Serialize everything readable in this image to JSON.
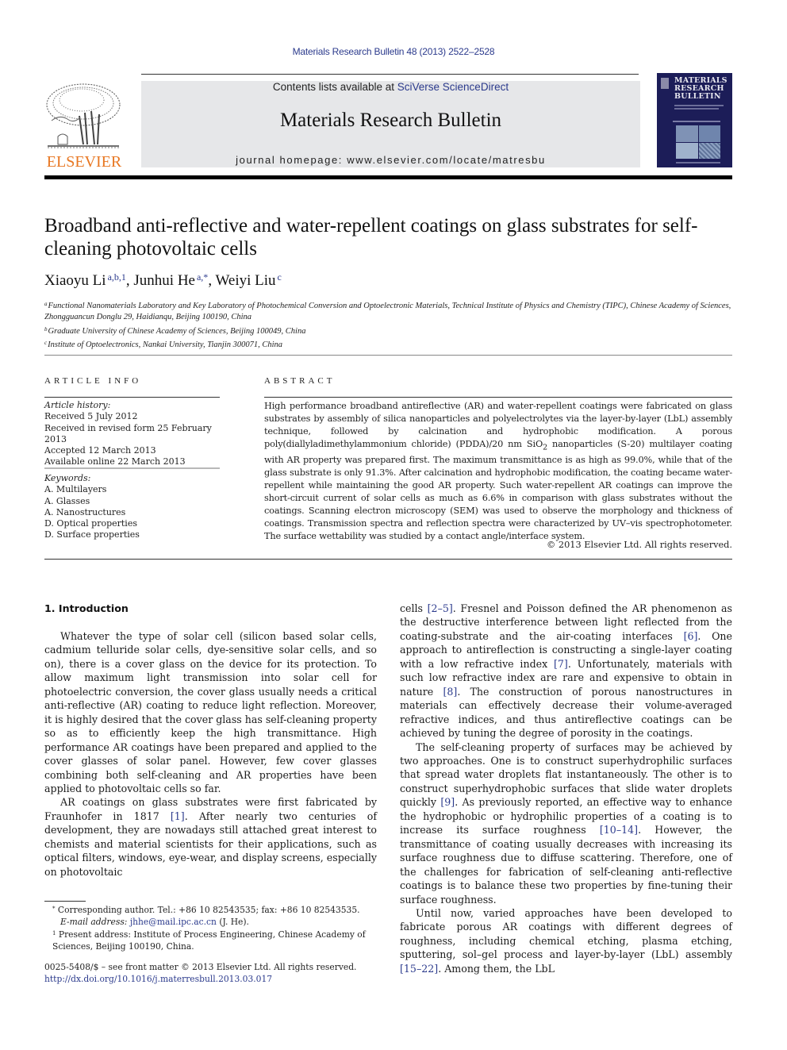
{
  "header": {
    "journal_citation": "Materials Research Bulletin 48 (2013) 2522–2528",
    "contents_prefix": "Contents lists available at ",
    "contents_link": "SciVerse ScienceDirect",
    "journal_name": "Materials Research Bulletin",
    "homepage_prefix": "journal homepage: ",
    "homepage_url": "www.elsevier.com/locate/matresbu",
    "publisher_logo_text": "ELSEVIER",
    "cover_title_lines": [
      "MATERIALS",
      "RESEARCH",
      "BULLETIN"
    ],
    "colors": {
      "link": "#2b3a8c",
      "elsevier_orange": "#e87722",
      "masthead_bg": "#e6e7e9",
      "cover_bg": "#1c1d58"
    }
  },
  "article": {
    "title": "Broadband anti-reflective and water-repellent coatings on glass substrates for self-cleaning photovoltaic cells",
    "authors": [
      {
        "name": "Xiaoyu Li",
        "marks": "a,b,1",
        "sep": ", "
      },
      {
        "name": "Junhui He",
        "marks": "a,*",
        "sep": ", "
      },
      {
        "name": "Weiyi Liu",
        "marks": "c",
        "sep": ""
      }
    ],
    "affiliations": [
      {
        "mark": "a",
        "text": "Functional Nanomaterials Laboratory and Key Laboratory of Photochemical Conversion and Optoelectronic Materials, Technical Institute of Physics and Chemistry (TIPC), Chinese Academy of Sciences, Zhongguancun Donglu 29, Haidianqu, Beijing 100190, China"
      },
      {
        "mark": "b",
        "text": "Graduate University of Chinese Academy of Sciences, Beijing 100049, China"
      },
      {
        "mark": "c",
        "text": "Institute of Optoelectronics, Nankai University, Tianjin 300071, China"
      }
    ]
  },
  "article_info": {
    "heading": "ARTICLE INFO",
    "history_label": "Article history:",
    "history": [
      "Received 5 July 2012",
      "Received in revised form 25 February 2013",
      "Accepted 12 March 2013",
      "Available online 22 March 2013"
    ],
    "keywords_label": "Keywords:",
    "keywords": [
      "A. Multilayers",
      "A. Glasses",
      "A. Nanostructures",
      "D. Optical properties",
      "D. Surface properties"
    ]
  },
  "abstract": {
    "heading": "ABSTRACT",
    "text_before_sub": "High performance broadband antireflective (AR) and water-repellent coatings were fabricated on glass substrates by assembly of silica nanoparticles and polyelectrolytes via the layer-by-layer (LbL) assembly technique, followed by calcination and hydrophobic modification. A porous poly(diallyladimethylammonium chloride) (PDDA)/20 nm SiO",
    "subscript": "2",
    "text_after_sub": " nanoparticles (S-20) multilayer coating with AR property was prepared first. The maximum transmittance is as high as 99.0%, while that of the glass substrate is only 91.3%. After calcination and hydrophobic modification, the coating became water-repellent while maintaining the good AR property. Such water-repellent AR coatings can improve the short-circuit current of solar cells as much as 6.6% in comparison with glass substrates without the coatings. Scanning electron microscopy (SEM) was used to observe the morphology and thickness of coatings. Transmission spectra and reflection spectra were characterized by UV–vis spectrophotometer. The surface wettability was studied by a contact angle/interface system.",
    "copyright": "© 2013 Elsevier Ltd. All rights reserved."
  },
  "body": {
    "section_heading": "1.  Introduction",
    "left": {
      "p1": "Whatever the type of solar cell (silicon based solar cells, cadmium telluride solar cells, dye-sensitive solar cells, and so on), there is a cover glass on the device for its protection. To allow maximum light transmission into solar cell for photoelectric conversion, the cover glass usually needs a critical anti-reflective (AR) coating to reduce light reflection. Moreover, it is highly desired that the cover glass has self-cleaning property so as to efficiently keep the high transmittance. High performance AR coatings have been prepared and applied to the cover glasses of solar panel. However, few cover glasses combining both self-cleaning and AR properties have been applied to photovoltaic cells so far.",
      "p2_a": "AR coatings on glass substrates were first fabricated by Fraunhofer in 1817 ",
      "p2_ref1": "[1]",
      "p2_b": ". After nearly two centuries of development, they are nowadays still attached great interest to chemists and material scientists for their applications, such as optical filters, windows, eye-wear, and display screens, especially on photovoltaic"
    },
    "right": {
      "p1_a": "cells ",
      "p1_ref1": "[2–5]",
      "p1_b": ". Fresnel and Poisson defined the AR phenomenon as the destructive interference between light reflected from the coating-substrate and the air-coating interfaces ",
      "p1_ref2": "[6]",
      "p1_c": ". One approach to antireflection is constructing a single-layer coating with a low refractive index ",
      "p1_ref3": "[7]",
      "p1_d": ". Unfortunately, materials with such low refractive index are rare and expensive to obtain in nature ",
      "p1_ref4": "[8]",
      "p1_e": ". The construction of porous nanostructures in materials can effectively decrease their volume-averaged refractive indices, and thus antireflective coatings can be achieved by tuning the degree of porosity in the coatings.",
      "p2_a": "The self-cleaning property of surfaces may be achieved by two approaches. One is to construct superhydrophilic surfaces that spread water droplets flat instantaneously. The other is to construct superhydrophobic surfaces that slide water droplets quickly ",
      "p2_ref1": "[9]",
      "p2_b": ". As previously reported, an effective way to enhance the hydrophobic or hydrophilic properties of a coating is to increase its surface roughness ",
      "p2_ref2": "[10–14]",
      "p2_c": ". However, the transmittance of coating usually decreases with increasing its surface roughness due to diffuse scattering. Therefore, one of the challenges for fabrication of self-cleaning anti-reflective coatings is to balance these two properties by fine-tuning their surface roughness.",
      "p3_a": "Until now, varied approaches have been developed to fabricate porous AR coatings with different degrees of roughness, including chemical etching, plasma etching, sputtering, sol–gel process and layer-by-layer (LbL) assembly ",
      "p3_ref1": "[15–22]",
      "p3_b": ". Among them, the LbL"
    }
  },
  "footnotes": {
    "corresponding_mark": "*",
    "corresponding": "Corresponding author. Tel.: +86 10 82543535; fax: +86 10 82543535.",
    "email_label": "E-mail address: ",
    "email": "jhhe@mail.ipc.ac.cn",
    "email_suffix": " (J. He).",
    "present_mark": "1",
    "present_address": "Present address: Institute of Process Engineering, Chinese Academy of Sciences, Beijing 100190, China.",
    "front_matter": "0025-5408/$ – see front matter © 2013 Elsevier Ltd. All rights reserved.",
    "doi": "http://dx.doi.org/10.1016/j.materresbull.2013.03.017"
  }
}
